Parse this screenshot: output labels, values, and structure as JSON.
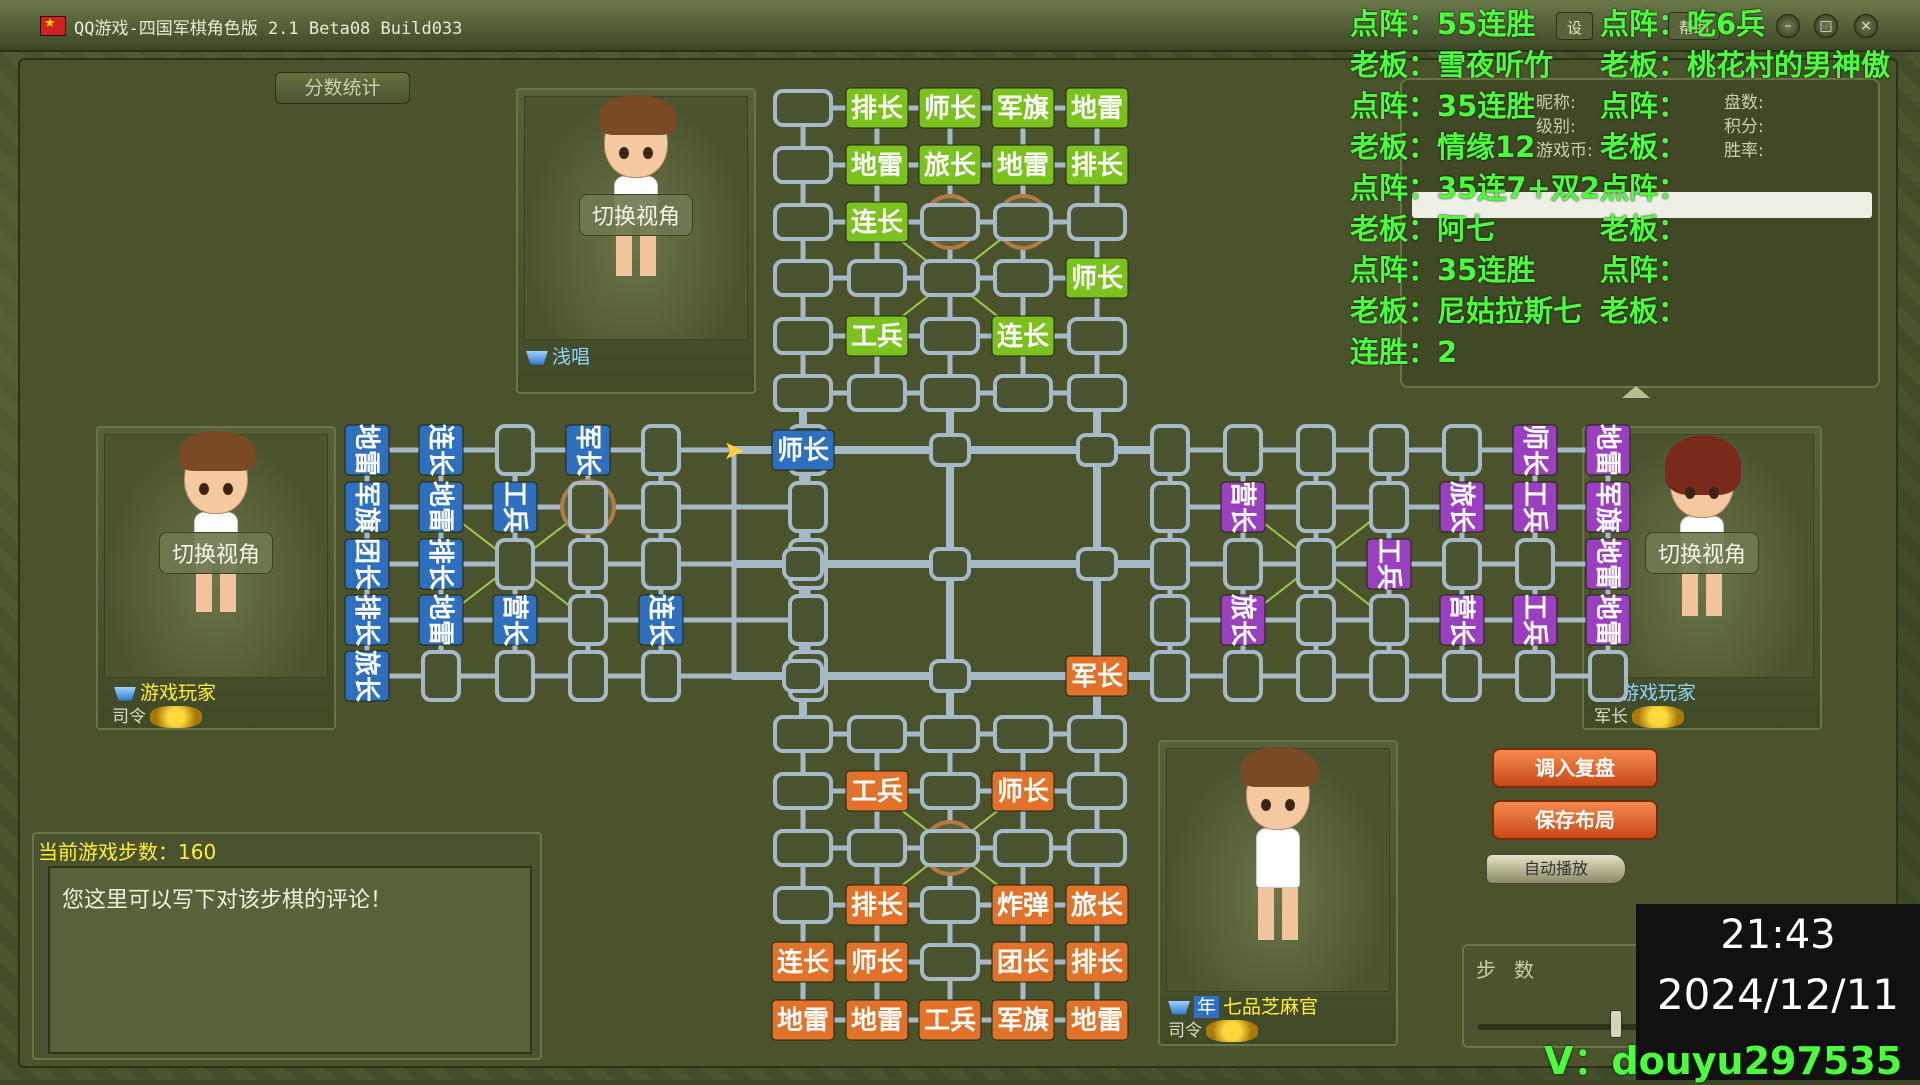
{
  "window": {
    "title": "QQ游戏-四国军棋角色版 2.1 Beta08 Build033",
    "setting_label": "设",
    "help_label": "帮助"
  },
  "stats_tab": "分数统计",
  "overlay": [
    [
      "点阵：55连胜",
      "点阵：吃6兵"
    ],
    [
      "老板：雪夜听竹",
      "老板：桃花村的男神傲"
    ],
    [
      "点阵：35连胜",
      "点阵："
    ],
    [
      "老板：情缘12",
      "老板："
    ],
    [
      "点阵：35连7+双2",
      "点阵："
    ],
    [
      "老板：阿七",
      "老板："
    ],
    [
      "点阵：35连胜",
      "点阵："
    ],
    [
      "老板：尼姑拉斯七",
      "老板："
    ],
    [
      "连胜：2",
      ""
    ]
  ],
  "info_labels": {
    "nick": "昵称:",
    "level": "级别:",
    "coin": "游戏币:",
    "games": "盘数:",
    "score": "积分:",
    "winrate": "胜率:"
  },
  "players": {
    "top": {
      "switch": "切换视角",
      "name": "浅唱"
    },
    "left": {
      "switch": "切换视角",
      "name": "游戏玩家",
      "rank": "司令"
    },
    "right": {
      "switch": "切换视角",
      "name": "游戏玩家",
      "rank": "军长"
    },
    "bottom": {
      "name": "七品芝麻官",
      "rank": "司令",
      "tag": "年"
    }
  },
  "move": {
    "header": "当前游戏步数：160",
    "comment": "您这里可以写下对该步棋的评论！"
  },
  "buttons": {
    "load": "调入复盘",
    "save": "保存布局",
    "auto": "自动播放"
  },
  "steps_label": "步数",
  "clock": {
    "time": "21:43",
    "date": "2024/12/11"
  },
  "wechat": "V：douyu297535",
  "colors": {
    "green": "#7cc21f",
    "blue": "#2f6fc0",
    "purple": "#9a3fc0",
    "orange": "#e2712a",
    "track": "#a6b9c7"
  },
  "pieces": {
    "top": [
      [
        "",
        "排长",
        "师长",
        "军旗",
        "地雷"
      ],
      [
        "",
        "地雷",
        "旅长",
        "地雷",
        "排长"
      ],
      [
        "",
        "连长",
        "",
        "",
        "",
        ""
      ],
      [
        "",
        "",
        "",
        "",
        "师长"
      ],
      [
        "",
        "工兵",
        "",
        "连长",
        ""
      ],
      [
        "",
        "",
        "",
        "",
        ""
      ]
    ],
    "bottom": [
      [
        "",
        "",
        "",
        "",
        ""
      ],
      [
        "",
        "工兵",
        "",
        "师长",
        ""
      ],
      [
        "",
        "",
        "",
        "",
        ""
      ],
      [
        "",
        "排长",
        "",
        "炸弹",
        "旅长"
      ],
      [
        "连长",
        "师长",
        "",
        "团长",
        "排长"
      ],
      [
        "地雷",
        "地雷",
        "工兵",
        "军旗",
        "地雷"
      ]
    ],
    "left": [
      [
        "地雷",
        "连长",
        "",
        "军长",
        "",
        "",
        ""
      ],
      [
        "军旗",
        "地雷",
        "工兵",
        "",
        "",
        "",
        ""
      ],
      [
        "团长",
        "排长",
        "",
        "",
        "",
        "",
        ""
      ],
      [
        "排长",
        "地雷",
        "营长",
        "",
        "连长",
        "",
        ""
      ],
      [
        "旅长",
        "",
        "",
        "",
        "",
        "",
        ""
      ]
    ],
    "right": [
      [
        "",
        "",
        "",
        "",
        "",
        "师长",
        "地雷"
      ],
      [
        "",
        "营长",
        "",
        "",
        "旅长",
        "工兵",
        "军旗"
      ],
      [
        "",
        "",
        "",
        "工兵",
        "",
        "",
        "地雷"
      ],
      [
        "",
        "旅长",
        "",
        "",
        "营长",
        "工兵",
        "地雷"
      ],
      [
        "",
        "",
        "",
        "",
        "",
        "",
        ""
      ]
    ],
    "center": [
      {
        "label": "师长",
        "side": "blue",
        "col": 0,
        "row": 0
      },
      {
        "label": "军长",
        "side": "orange",
        "col": 2,
        "row": 2
      }
    ]
  }
}
